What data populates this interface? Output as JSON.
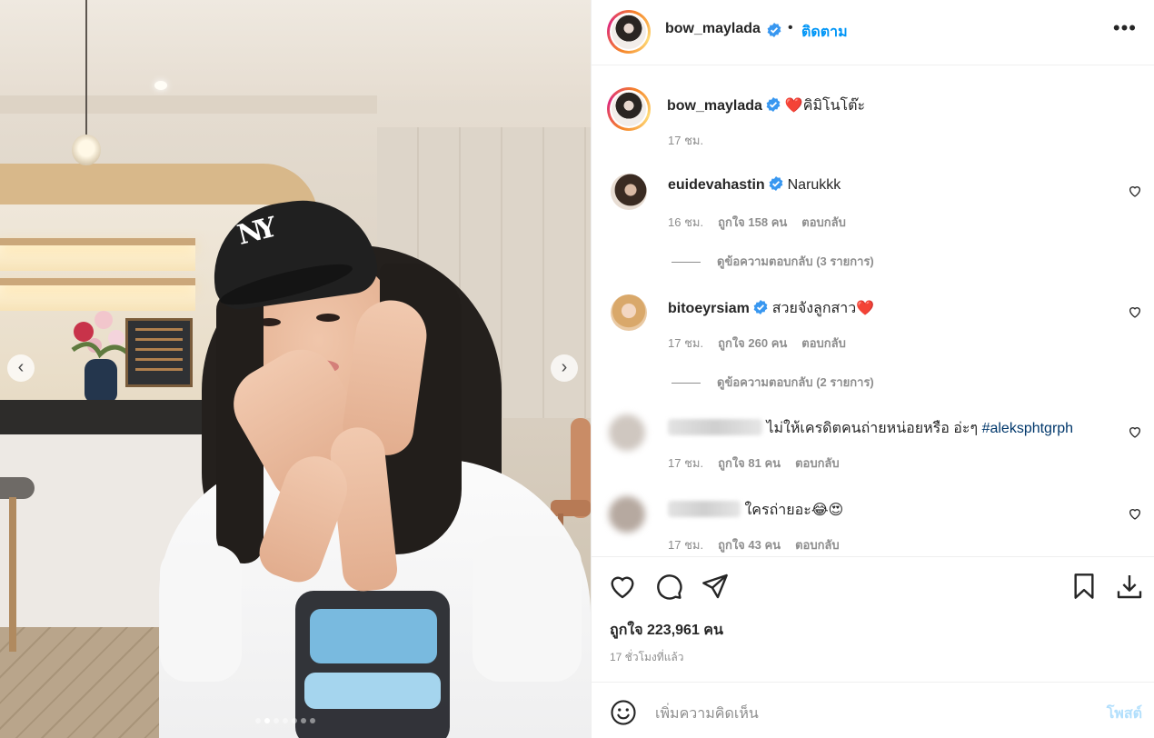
{
  "colors": {
    "link_blue": "#0095f6",
    "verified_blue": "#3897f0",
    "meta_gray": "#8e8e8e",
    "heart_red": "#ed4956",
    "post_disabled": "#b2dffc"
  },
  "photo": {
    "description_icon": "carousel-photo",
    "prev_icon": "chevron-left-icon",
    "next_icon": "chevron-right-icon",
    "prev_glyph": "‹",
    "next_glyph": "›",
    "cap_logo": "NY",
    "slide_count": 7,
    "active_slide": 2
  },
  "header": {
    "username": "bow_maylada",
    "bullet": "•",
    "follow_label": "ติดตาม",
    "more_glyph": "•••"
  },
  "caption": {
    "username": "bow_maylada",
    "text": "คิมิโนโต๊ะ",
    "emoji": "❤️",
    "time": "17 ชม."
  },
  "comments": [
    {
      "username": "euidevahastin",
      "verified": true,
      "text": "Narukkk",
      "time": "16 ชม.",
      "likes": "ถูกใจ 158 คน",
      "reply": "ตอบกลับ",
      "view_replies": "ดูข้อความตอบกลับ (3 รายการ)"
    },
    {
      "username": "bitoeyrsiam",
      "verified": true,
      "text": "สวยจังลูกสาว",
      "emoji": "❤️",
      "time": "17 ชม.",
      "likes": "ถูกใจ 260 คน",
      "reply": "ตอบกลับ",
      "view_replies": "ดูข้อความตอบกลับ (2 รายการ)"
    },
    {
      "username_blurred": true,
      "text": "ไม่ให้เครดิตคนถ่ายหน่อยหรือ อ่ะๆ",
      "hashtag": "#aleksphtgrph",
      "time": "17 ชม.",
      "likes": "ถูกใจ 81 คน",
      "reply": "ตอบกลับ"
    },
    {
      "username_blurred": true,
      "text": "ใครถ่ายอะ",
      "emoji": "😂😍",
      "time": "17 ชม.",
      "likes": "ถูกใจ 43 คน",
      "reply": "ตอบกลับ"
    }
  ],
  "actions": {
    "like_icon": "heart-icon",
    "comment_icon": "comment-icon",
    "share_icon": "paper-plane-icon",
    "save_icon": "bookmark-icon",
    "download_icon": "download-icon",
    "likes_total": "ถูกใจ 223,961 คน",
    "time_ago": "17 ชั่วโมงที่แล้ว"
  },
  "add_comment": {
    "emoji_icon": "smiley-icon",
    "placeholder": "เพิ่มความคิดเห็น",
    "post_label": "โพสต์"
  }
}
